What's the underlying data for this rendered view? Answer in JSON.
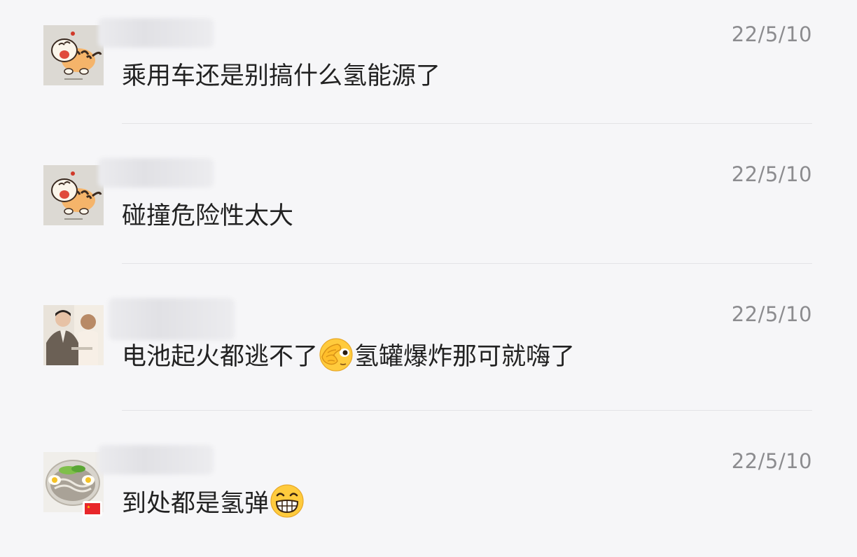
{
  "comments": [
    {
      "avatar": "tiger-avatar",
      "timestamp": "22/5/10",
      "text": "乘用车还是别搞什么氢能源了"
    },
    {
      "avatar": "tiger-avatar",
      "timestamp": "22/5/10",
      "text": "碰撞危险性太大"
    },
    {
      "avatar": "couple-photo-avatar",
      "timestamp": "22/5/10",
      "text_before_emoji": "电池起火都逃不了",
      "emoji": "face-palm-peek-emoji",
      "text_after_emoji": "氢罐爆炸那可就嗨了"
    },
    {
      "avatar": "food-bowl-avatar",
      "badge": "china-flag-icon",
      "timestamp": "22/5/10",
      "text": "到处都是氢弹",
      "emoji": "grinning-teeth-emoji"
    }
  ],
  "colors": {
    "background": "#f6f6f8",
    "text": "#222222",
    "timestamp": "#8c8c8f",
    "divider": "#e3e3e6"
  }
}
